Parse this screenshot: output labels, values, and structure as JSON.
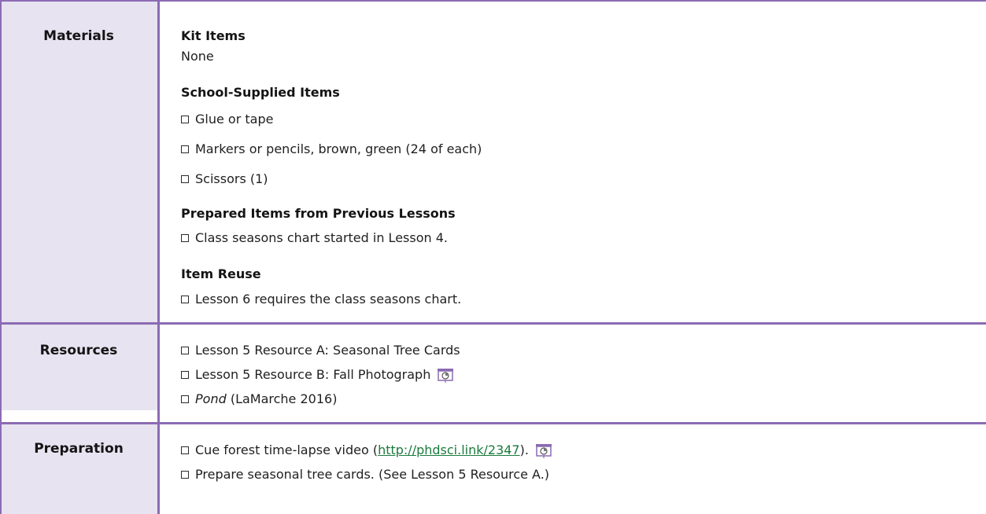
{
  "rows": {
    "materials": {
      "label": "Materials",
      "kit_heading": "Kit Items",
      "kit_value": "None",
      "school_heading": "School-Supplied Items",
      "school_items": [
        "Glue or tape",
        "Markers or pencils, brown, green (24 of each)",
        "Scissors (1)"
      ],
      "prepared_heading": "Prepared Items from Previous Lessons",
      "prepared_items": [
        "Class seasons chart started in Lesson 4."
      ],
      "reuse_heading": "Item Reuse",
      "reuse_items": [
        "Lesson 6 requires the class seasons chart."
      ]
    },
    "resources": {
      "label": "Resources",
      "items": [
        "Lesson 5 Resource A: Seasonal Tree Cards",
        "Lesson 5 Resource B: Fall Photograph"
      ],
      "book_title": "Pond",
      "book_rest": " (LaMarche 2016)"
    },
    "preparation": {
      "label": "Preparation",
      "item1_before": "Cue forest time-lapse video (",
      "item1_link": "http://phdsci.link/2347",
      "item1_after": ").",
      "item2": "Prepare seasonal tree cards. (See Lesson 5 Resource A.)"
    }
  },
  "icons": {
    "projection": "projector-screen-icon",
    "checkbox": "checkbox-icon"
  },
  "colors": {
    "accent": "#8b6bb3",
    "header_fill": "#e8e3f1",
    "link": "#1a7a3c"
  }
}
